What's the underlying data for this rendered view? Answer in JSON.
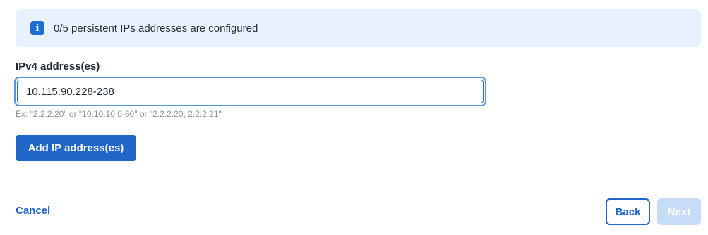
{
  "banner": {
    "icon": "info-icon",
    "icon_glyph": "i",
    "text": "0/5 persistent IPs addresses are configured"
  },
  "ipv4_field": {
    "label": "IPv4 address(es)",
    "value": "10.115.90.228-238",
    "hint": "Ex: \"2.2.2.20\" or \"10.10.10.0-60\" or \"2.2.2.20, 2.2.2.21\""
  },
  "actions": {
    "add_label": "Add IP address(es)",
    "cancel_label": "Cancel",
    "back_label": "Back",
    "next_label": "Next",
    "next_disabled": true
  },
  "colors": {
    "accent": "#1f66c8",
    "banner_bg": "#e8f1fe",
    "disabled_button": "#c7dcf7"
  }
}
